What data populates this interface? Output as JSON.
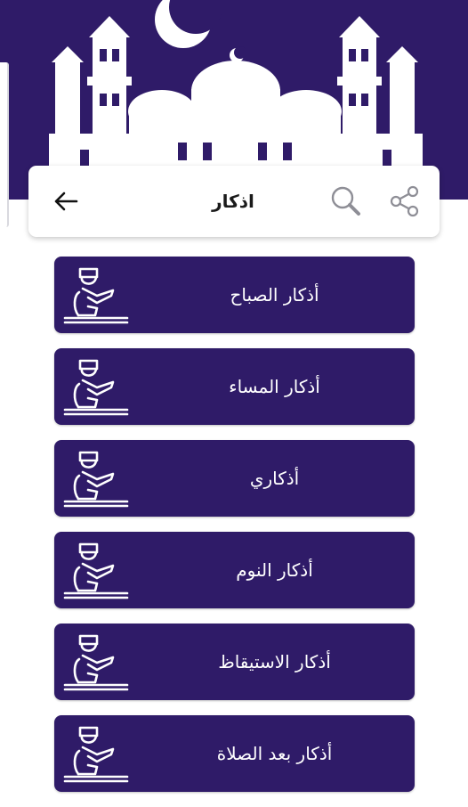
{
  "header": {
    "title": "اذكار",
    "back_icon": "arrow-left-icon",
    "search_icon": "search-icon",
    "share_icon": "share-icon"
  },
  "colors": {
    "primary": "#2f1b68",
    "on_primary": "#ffffff",
    "toolbar_bg": "#ffffff"
  },
  "menu": {
    "items": [
      {
        "label": "أذكار الصباح",
        "icon": "praying-man-icon"
      },
      {
        "label": "أذكار المساء",
        "icon": "praying-man-icon"
      },
      {
        "label": "أذكاري",
        "icon": "praying-man-icon"
      },
      {
        "label": "أذكار النوم",
        "icon": "praying-man-icon"
      },
      {
        "label": "أذكار الاستيقاظ",
        "icon": "praying-man-icon"
      },
      {
        "label": "أذكار بعد الصلاة",
        "icon": "praying-man-icon"
      }
    ]
  }
}
